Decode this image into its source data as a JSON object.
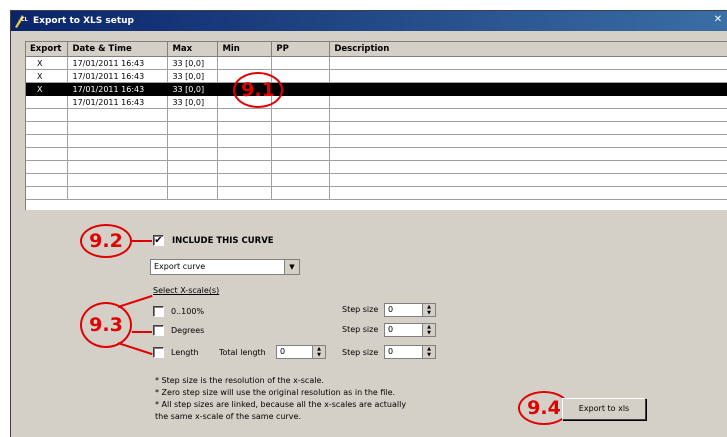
{
  "window": {
    "title": "Export to XLS setup",
    "close_glyph": "✕",
    "icon": "app-icon"
  },
  "grid": {
    "columns": [
      "Export",
      "Date & Time",
      "Max",
      "Min",
      "PP",
      "Description"
    ],
    "rows": [
      {
        "export": "X",
        "datetime": "17/01/2011 16:43",
        "max": "33 [0,0]",
        "min": "",
        "pp": "",
        "description": ""
      },
      {
        "export": "X",
        "datetime": "17/01/2011 16:43",
        "max": "33 [0,0]",
        "min": "",
        "pp": "",
        "description": ""
      },
      {
        "export": "X",
        "datetime": "17/01/2011 16:43",
        "max": "33 [0,0]",
        "min": "",
        "pp": "",
        "description": ""
      },
      {
        "export": "",
        "datetime": "17/01/2011 16:43",
        "max": "33 [0,0]",
        "min": "",
        "pp": "",
        "description": ""
      }
    ],
    "selected_row": 2
  },
  "callouts": {
    "c91": "9.1",
    "c92": "9.2",
    "c93": "9.3",
    "c94": "9.4"
  },
  "include": {
    "label": "INCLUDE THIS CURVE",
    "checked": true,
    "check_glyph": "✔"
  },
  "combo": {
    "value": "Export curve",
    "arrow": "▼"
  },
  "xscale": {
    "heading": "Select X-scale(s)",
    "opt1": "0..100%",
    "opt2": "Degrees",
    "opt3": "Length",
    "total_length_label": "Total length",
    "total_length_value": "0",
    "step_label": "Step size",
    "step1": "0",
    "step2": "0",
    "step3": "0"
  },
  "notes": [
    "* Step size is the resolution of the x-scale.",
    "* Zero step size will use the original resolution as in the file.",
    "* All step sizes are linked, because all the x-scales are actually",
    "the same x-scale of the same curve."
  ],
  "export_button": "Export to xls",
  "spin_glyphs": {
    "up": "▲",
    "down": "▼"
  }
}
